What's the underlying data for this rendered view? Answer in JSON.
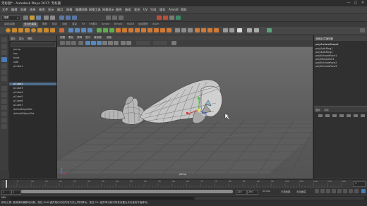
{
  "titlebar": {
    "title": "无标题* - Autodesk Maya 2017: 无标题",
    "buttons": [
      "—",
      "□",
      "✕"
    ]
  },
  "menubar": {
    "items": [
      "文件",
      "编辑",
      "创建",
      "选择",
      "修改",
      "显示",
      "窗口",
      "网格",
      "编辑网格",
      "网格工具",
      "网格显示",
      "曲线",
      "曲面",
      "变形",
      "UV",
      "生成",
      "缓存",
      "Arnold",
      "帮助"
    ]
  },
  "statusline": {
    "mode": "建模",
    "icons": [
      "new-scene",
      "open-scene",
      "save-scene",
      "undo",
      "redo",
      "select-hierarchy",
      "select-object",
      "select-component",
      "snap-grid",
      "snap-curve",
      "snap-point",
      "render",
      "ipr",
      "render-settings",
      "hypershade"
    ]
  },
  "shelf": {
    "tabs": [
      "曲线/曲面",
      "多边形建模",
      "雕刻",
      "绑定",
      "动画",
      "渲染",
      "FX",
      "FX缓存",
      "Arnold",
      "Bifrost",
      "MASH",
      "运动图形",
      "XGen"
    ],
    "active_tab": 1
  },
  "toolbox": {
    "tools": [
      "select-tool",
      "lasso-tool",
      "paint-select-tool",
      "move-tool",
      "rotate-tool",
      "scale-tool",
      "last-tool",
      "single-view",
      "four-view",
      "outliner-layout"
    ]
  },
  "outliner": {
    "menu": [
      "显示",
      "显示",
      "帮助"
    ],
    "items": [
      "persp",
      "top",
      "front",
      "side",
      "pCube1",
      "pCube2",
      "pCube3",
      "pCube4",
      "pCube5",
      "pCube6",
      "pCube7",
      "defaultLightSet",
      "defaultObjectSet"
    ],
    "selected_index": 5
  },
  "viewport": {
    "menu": [
      "视图",
      "着色",
      "照明",
      "显示",
      "渲染器",
      "面板"
    ],
    "camera_label": "persp"
  },
  "rightpanel": {
    "tabs": [
      "通道盒/层编辑器"
    ],
    "items": [
      "polySurfaceShape1",
      "polySplitRing1",
      "polySplitRing2",
      "polyExtrudeFace1",
      "polyMergeVert1",
      "polyExtrudeFace2",
      "polyExtrudeFace3"
    ],
    "layer_tabs": [
      "显示",
      "动画"
    ]
  },
  "timeslider": {
    "ticks": [
      "1",
      "5",
      "10",
      "15",
      "20",
      "25",
      "30",
      "35",
      "40",
      "45",
      "50",
      "55",
      "60",
      "65",
      "70",
      "75",
      "80",
      "85",
      "90",
      "95",
      "100",
      "105",
      "110",
      "115",
      "120"
    ],
    "current": "1"
  },
  "rangeslider": {
    "start": "1",
    "end": "120",
    "range_end": "120",
    "max_end": "200",
    "char_set": "无角色集",
    "anim_layer": "无动画层",
    "fps": "24 fps"
  },
  "helpline": {
    "text": "移动工具: 使用操纵器移动对象。按住 Shift 键并拖动可在所有方向上同时移动。按住 Ctrl 键并单击轴可将其设置为未约束的平面移动。"
  },
  "colors": {
    "accent": "#4b7bb3",
    "viewport_top": "#6e6e6e",
    "viewport_bottom": "#545454"
  }
}
